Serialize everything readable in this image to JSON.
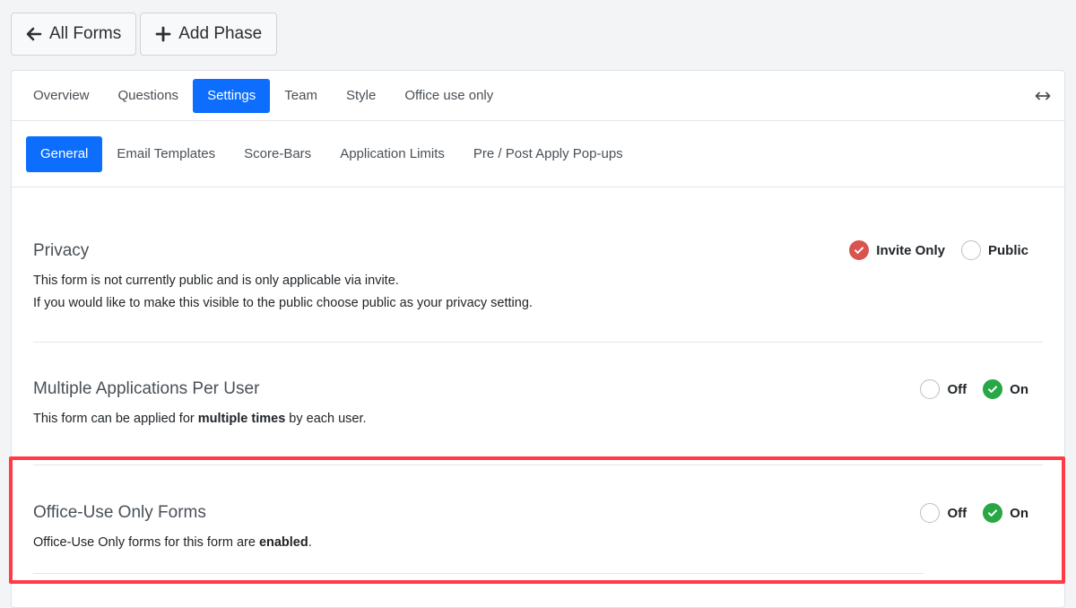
{
  "topbar": {
    "all_forms_label": "All Forms",
    "add_phase_label": "Add Phase"
  },
  "tabs": [
    {
      "label": "Overview",
      "active": false
    },
    {
      "label": "Questions",
      "active": false
    },
    {
      "label": "Settings",
      "active": true
    },
    {
      "label": "Team",
      "active": false
    },
    {
      "label": "Style",
      "active": false
    },
    {
      "label": "Office use only",
      "active": false
    }
  ],
  "subtabs": [
    {
      "label": "General",
      "active": true
    },
    {
      "label": "Email Templates",
      "active": false
    },
    {
      "label": "Score-Bars",
      "active": false
    },
    {
      "label": "Application Limits",
      "active": false
    },
    {
      "label": "Pre / Post Apply Pop-ups",
      "active": false
    }
  ],
  "privacy": {
    "title": "Privacy",
    "line1": "This form is not currently public and is only applicable via invite.",
    "line2": "If you would like to make this visible to the public choose public as your privacy setting.",
    "option_invite": "Invite Only",
    "option_public": "Public",
    "selected": "Invite Only"
  },
  "multiple": {
    "title": "Multiple Applications Per User",
    "desc_prefix": "This form can be applied for ",
    "desc_bold": "multiple times",
    "desc_suffix": " by each user.",
    "option_off": "Off",
    "option_on": "On",
    "selected": "On"
  },
  "office": {
    "title": "Office-Use Only Forms",
    "desc_prefix": "Office-Use Only forms for this form are ",
    "desc_bold": "enabled",
    "desc_suffix": ".",
    "option_off": "Off",
    "option_on": "On",
    "selected": "On"
  },
  "colors": {
    "primary": "#0d6efd",
    "selected_red": "#d9534f",
    "selected_green": "#28a745",
    "highlight": "#ff3b46"
  }
}
